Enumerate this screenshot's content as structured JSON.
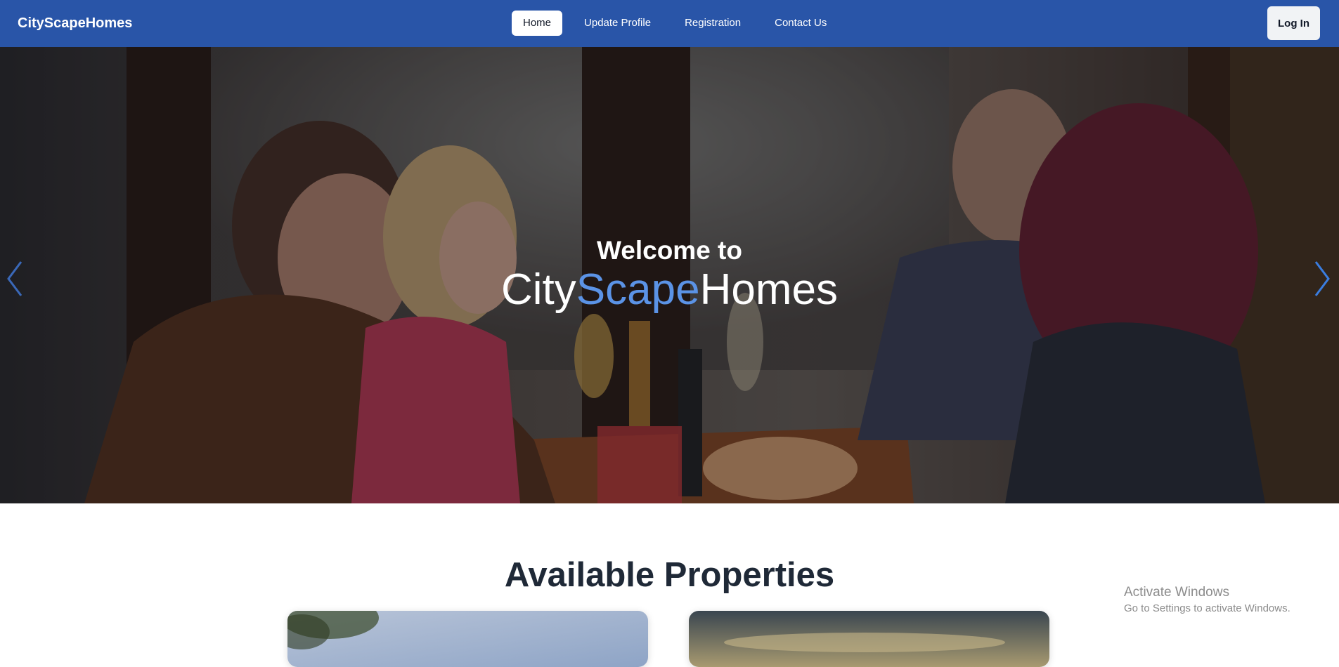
{
  "navbar": {
    "brand": "CityScapeHomes",
    "links": [
      {
        "label": "Home",
        "active": true
      },
      {
        "label": "Update Profile",
        "active": false
      },
      {
        "label": "Registration",
        "active": false
      },
      {
        "label": "Contact Us",
        "active": false
      }
    ],
    "login_label": "Log In",
    "background_color": "#2955a8"
  },
  "hero": {
    "welcome": "Welcome to",
    "title_part1": "City",
    "title_part2": "Scape",
    "title_part3": "Homes",
    "accent_color": "#5b93e6",
    "prev_icon": "chevron-left-icon",
    "next_icon": "chevron-right-icon"
  },
  "properties": {
    "title": "Available Properties"
  },
  "watermark": {
    "title": "Activate Windows",
    "subtitle": "Go to Settings to activate Windows."
  }
}
